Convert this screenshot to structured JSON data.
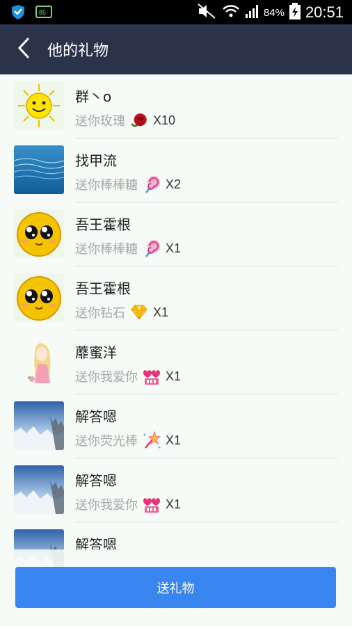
{
  "status_bar": {
    "battery_percent": "84%",
    "time": "20:51",
    "icons": [
      "shield-icon",
      "cpu-icon",
      "mute-icon",
      "wifi-icon",
      "signal-icon",
      "battery-icon"
    ]
  },
  "header": {
    "title": "他的礼物",
    "back_icon": "back-arrow-icon"
  },
  "gifts": [
    {
      "name": "群丶o",
      "text": "送你玫瑰",
      "icon": "rose-icon",
      "count": "X10",
      "avatar": "sun-avatar"
    },
    {
      "name": "找甲流",
      "text": "送你棒棒糖",
      "icon": "lollipop-icon",
      "count": "X2",
      "avatar": "water-avatar"
    },
    {
      "name": "吾王霍根",
      "text": "送你棒棒糖",
      "icon": "lollipop-icon",
      "count": "X1",
      "avatar": "smiley-avatar"
    },
    {
      "name": "吾王霍根",
      "text": "送你钻石",
      "icon": "diamond-icon",
      "count": "X1",
      "avatar": "smiley-avatar"
    },
    {
      "name": "蘼蜜洋",
      "text": "送你我爱你",
      "icon": "love-icon",
      "count": "X1",
      "avatar": "girl-avatar"
    },
    {
      "name": "解答嗯",
      "text": "送你荧光棒",
      "icon": "glowstick-icon",
      "count": "X1",
      "avatar": "sky-avatar"
    },
    {
      "name": "解答嗯",
      "text": "送你我爱你",
      "icon": "love-icon",
      "count": "X1",
      "avatar": "sky-avatar"
    },
    {
      "name": "解答嗯",
      "text": "",
      "icon": "",
      "count": "",
      "avatar": "sky-avatar"
    }
  ],
  "footer": {
    "send_button_label": "送礼物"
  },
  "colors": {
    "status_bar": "#000000",
    "title_bar": "#2b334b",
    "background": "#f6fbf7",
    "button": "#3a86f0",
    "muted_text": "#a7a7a7"
  }
}
